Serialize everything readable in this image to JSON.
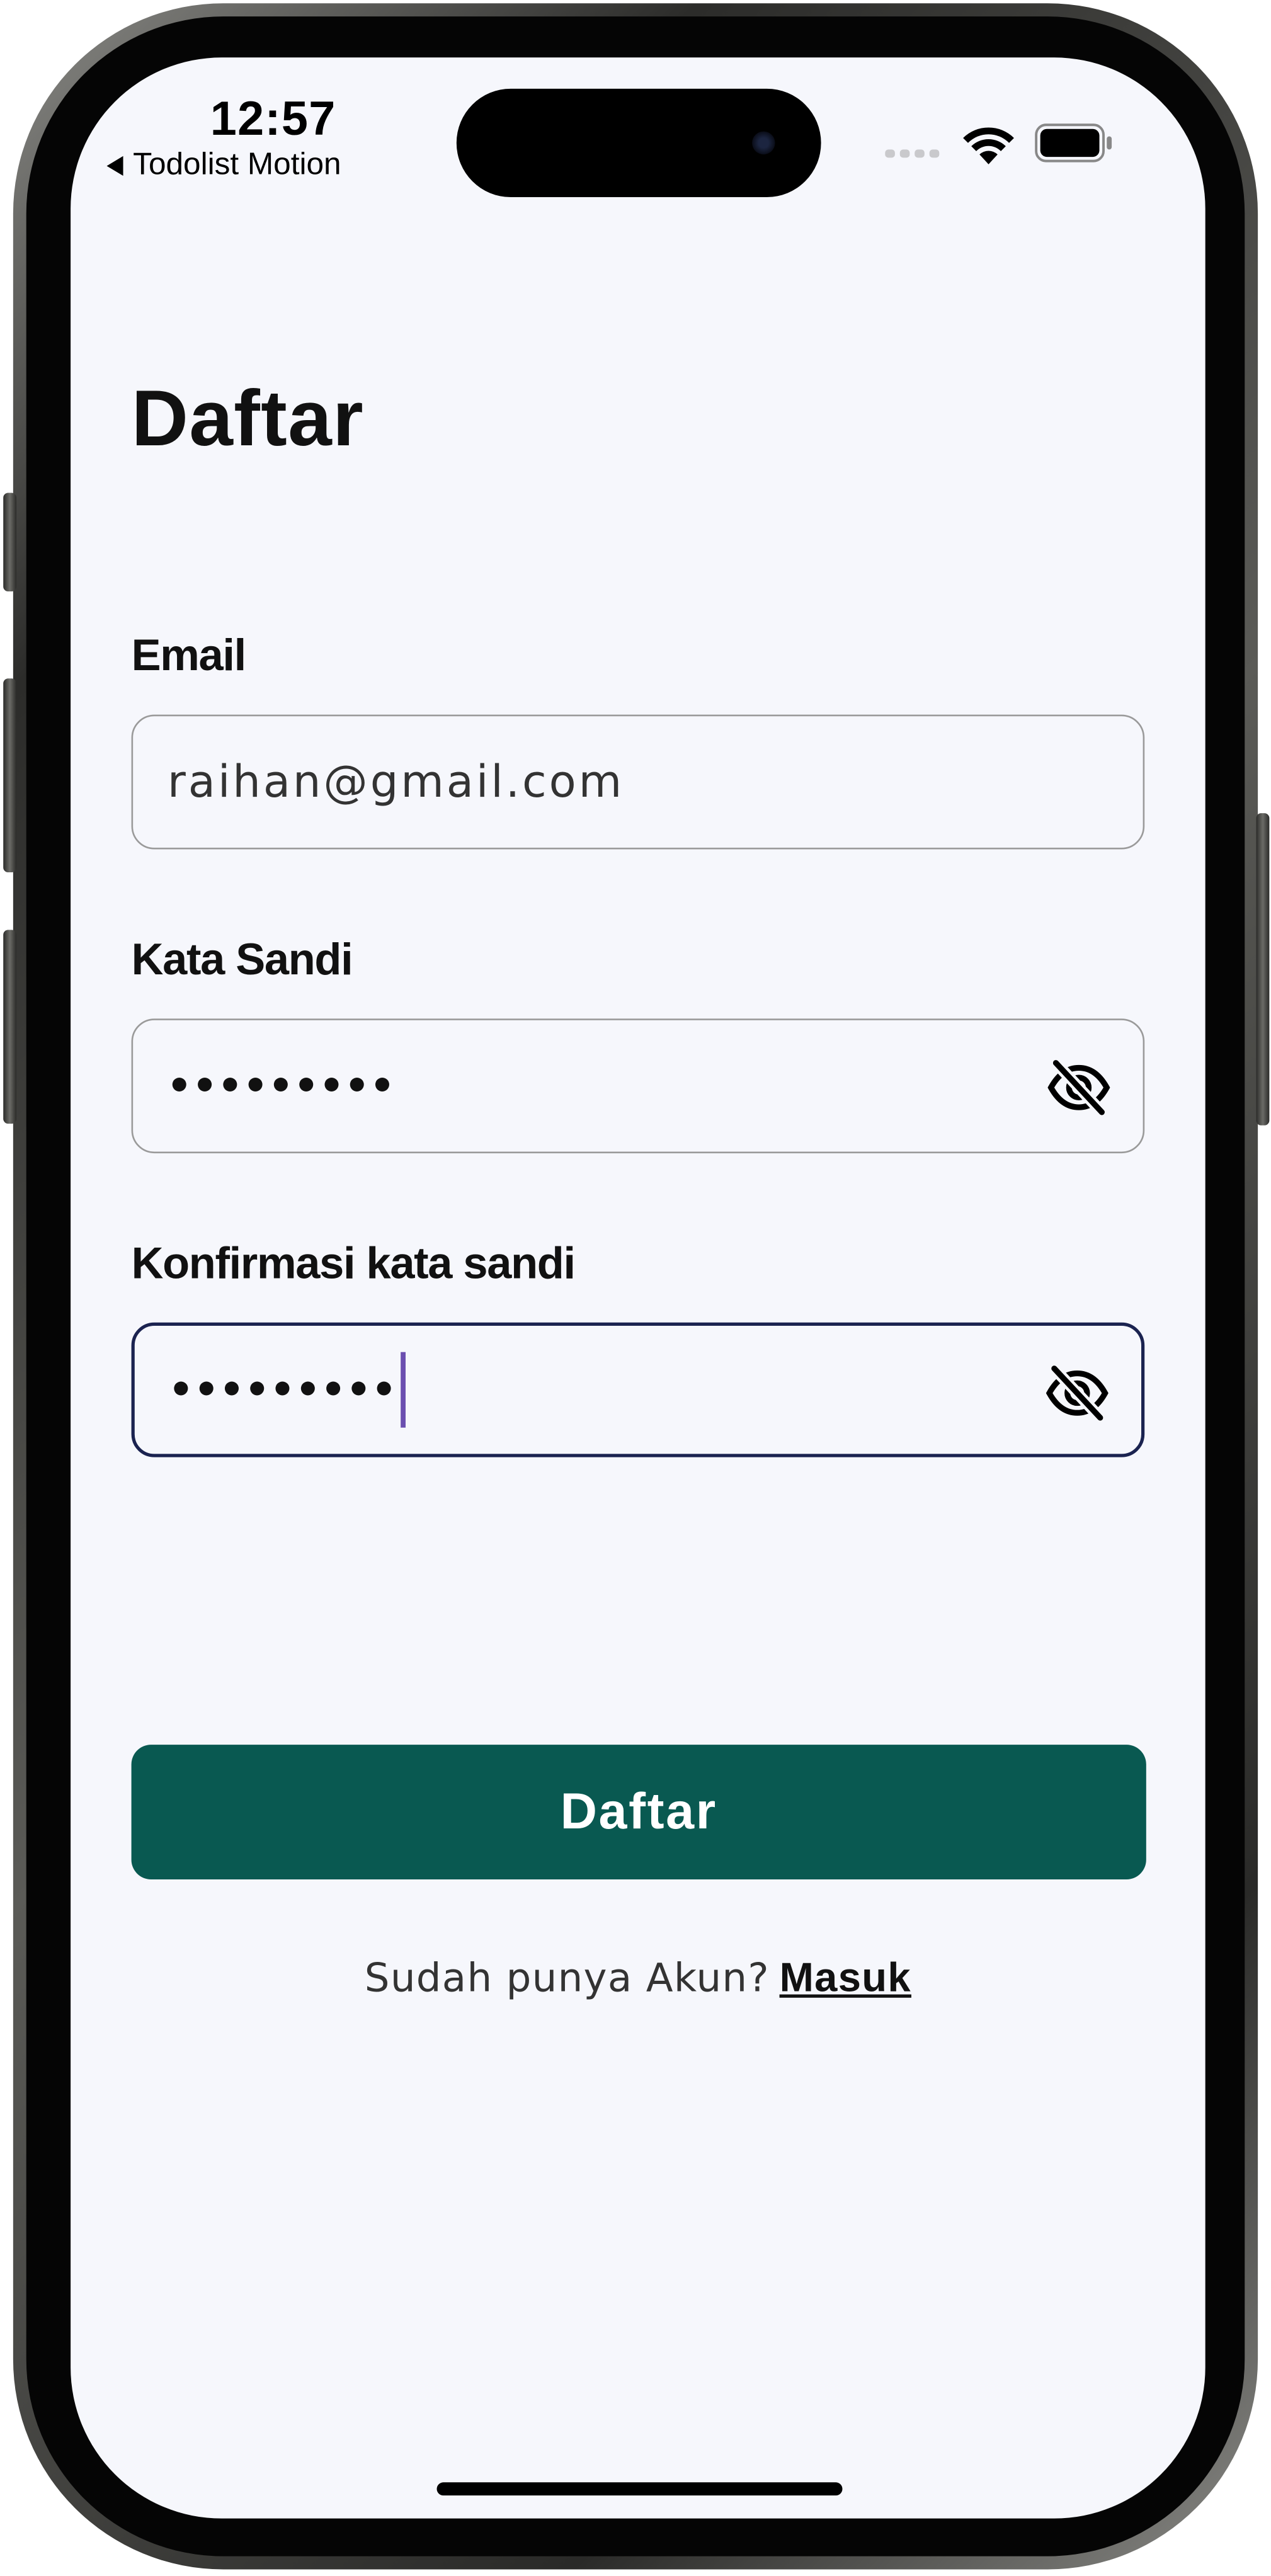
{
  "status_bar": {
    "time": "12:57",
    "back_app": "Todolist Motion"
  },
  "form": {
    "title": "Daftar",
    "email": {
      "label": "Email",
      "value": "raihan@gmail.com"
    },
    "password": {
      "label": "Kata Sandi",
      "value": "•••••••••"
    },
    "confirm_password": {
      "label": "Konfirmasi kata sandi",
      "value": "•••••••••"
    },
    "submit_label": "Daftar",
    "footer_text": "Sudah punya Akun?",
    "login_link": "Masuk"
  },
  "colors": {
    "primary": "#095951",
    "background": "#f6f7fc",
    "focus_border": "#1b2350",
    "caret": "#6b4fb0"
  },
  "icons": {
    "back": "chevron-left-icon",
    "wifi": "wifi-icon",
    "battery": "battery-icon",
    "password_toggle": "eye-off-icon"
  }
}
